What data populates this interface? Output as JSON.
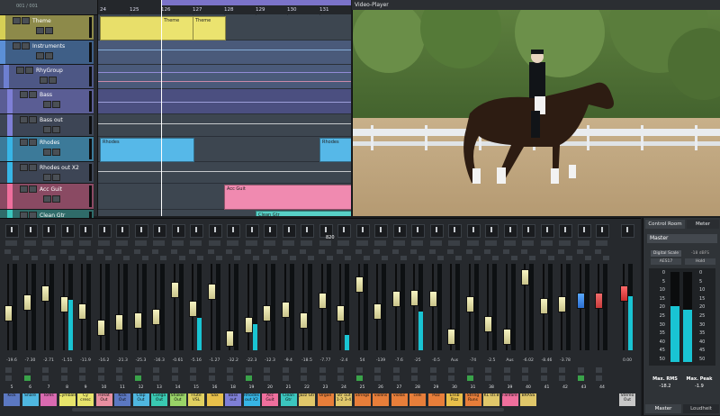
{
  "tracklist": {
    "header": "001 / 001",
    "tracks": [
      {
        "name": "Theme",
        "color": "#d6cf55",
        "row_bg": "#8d8a4a",
        "height": 27
      },
      {
        "name": "Instruments",
        "color": "#5b8fd6",
        "row_bg": "#3f5f87",
        "height": 26
      },
      {
        "name": "RhyGroup",
        "color": "#6d7fd0",
        "row_bg": "#4d5785",
        "height": 26
      },
      {
        "name": "Bass",
        "color": "#7e7fd6",
        "row_bg": "#5a5d94",
        "height": 27
      },
      {
        "name": "Bass out",
        "color": "#7e7fd6",
        "row_bg": "#3d4555",
        "height": 24
      },
      {
        "name": "Rhodes",
        "color": "#37b5e6",
        "row_bg": "#3c7a99",
        "height": 27
      },
      {
        "name": "Rhodes out X2",
        "color": "#37b5e6",
        "row_bg": "#3d4555",
        "height": 23
      },
      {
        "name": "Acc Guit",
        "color": "#ef6f9d",
        "row_bg": "#8a4a63",
        "height": 28
      },
      {
        "name": "Clean Gtr",
        "color": "#3bc6be",
        "row_bg": "#2f6b69",
        "height": 14
      }
    ]
  },
  "arrange": {
    "bars": [
      "24",
      "125",
      "126",
      "127",
      "128",
      "129",
      "130",
      "131"
    ],
    "clips": [
      {
        "label": "",
        "lane": 0
      },
      {
        "label": "Theme",
        "lane": 0
      },
      {
        "label": "Theme",
        "lane": 0
      },
      {
        "label": "Rhodes",
        "lane": 5
      },
      {
        "label": "Rhodes",
        "lane": 5
      },
      {
        "label": "Acc Guit",
        "lane": 7
      },
      {
        "label": "Clean Gtr",
        "lane": 8
      }
    ]
  },
  "video": {
    "title": "Video-Player"
  },
  "mixer": {
    "input_marker": "820",
    "channels": [
      {
        "name": "Kick",
        "num": "5",
        "vol": "-19.6",
        "color": "#5b78c2",
        "level": 0.42,
        "meter": 0.0
      },
      {
        "name": "Snare",
        "num": "6",
        "vol": "-7.30",
        "color": "#4fb7e0",
        "level": 0.58,
        "meter": 0.0
      },
      {
        "name": "Toms",
        "num": "7",
        "vol": "-2.71",
        "color": "#d96ab0",
        "level": 0.7,
        "meter": 0.0
      },
      {
        "name": "Cymbals",
        "num": "8",
        "vol": "-1.51",
        "color": "#e7e46b",
        "level": 0.55,
        "meter": 0.58
      },
      {
        "name": "Cy cresc",
        "num": "9",
        "vol": "-11.9",
        "color": "#e7e46b",
        "level": 0.45,
        "meter": 0.0
      },
      {
        "name": "HiHat Out",
        "num": "10",
        "vol": "-16.2",
        "color": "#e88fa0",
        "level": 0.22,
        "meter": 0.0
      },
      {
        "name": "Kick Out",
        "num": "11",
        "vol": "-21.3",
        "color": "#5b78c2",
        "level": 0.3,
        "meter": 0.0
      },
      {
        "name": "Clap Out",
        "num": "12",
        "vol": "-25.3",
        "color": "#4fb7e0",
        "level": 0.33,
        "meter": 0.0
      },
      {
        "name": "Conga Out",
        "num": "13",
        "vol": "-16.3",
        "color": "#39c9b2",
        "level": 0.37,
        "meter": 0.0
      },
      {
        "name": "Shaker Out",
        "num": "14",
        "vol": "-0.61",
        "color": "#9ad468",
        "level": 0.75,
        "meter": 0.0
      },
      {
        "name": "Flute VSL",
        "num": "15",
        "vol": "-5.16",
        "color": "#e0d060",
        "level": 0.49,
        "meter": 0.38
      },
      {
        "name": "Sax",
        "num": "16",
        "vol": "-1.27",
        "color": "#e8c04a",
        "level": 0.73,
        "meter": 0.0
      },
      {
        "name": "Bass out",
        "num": "18",
        "vol": "-32.2",
        "color": "#7e7fd6",
        "level": 0.08,
        "meter": 0.0
      },
      {
        "name": "Rhodes out X2",
        "num": "19",
        "vol": "-22.3",
        "color": "#37b5e6",
        "level": 0.26,
        "meter": 0.3
      },
      {
        "name": "Acc Guit",
        "num": "20",
        "vol": "-12.3",
        "color": "#ef6f9d",
        "level": 0.42,
        "meter": 0.0
      },
      {
        "name": "Clean Gtr",
        "num": "21",
        "vol": "-9.4",
        "color": "#3bc6be",
        "level": 0.47,
        "meter": 0.0
      },
      {
        "name": "Jazz Gtr",
        "num": "22",
        "vol": "-18.5",
        "color": "#e0c76a",
        "level": 0.33,
        "meter": 0.0
      },
      {
        "name": "Organ",
        "num": "23",
        "vol": "-7.77",
        "color": "#e77e3a",
        "level": 0.6,
        "meter": 0.0
      },
      {
        "name": "Str out 1-2 3-4",
        "num": "24",
        "vol": "-2.4",
        "color": "#e0c76a",
        "level": 0.43,
        "meter": 0.18
      },
      {
        "name": "Strings",
        "num": "25",
        "vol": "54",
        "color": "#e77e3a",
        "level": 0.82,
        "meter": 0.0
      },
      {
        "name": "violins",
        "num": "26",
        "vol": "-139",
        "color": "#e77e3a",
        "level": 0.45,
        "meter": 0.0
      },
      {
        "name": "violas",
        "num": "27",
        "vol": "-7.6",
        "color": "#e77e3a",
        "level": 0.62,
        "meter": 0.0
      },
      {
        "name": "celli",
        "num": "28",
        "vol": "-25",
        "color": "#e77e3a",
        "level": 0.64,
        "meter": 0.45
      },
      {
        "name": "Pizz",
        "num": "29",
        "vol": "-0.5",
        "color": "#e77e3a",
        "level": 0.63,
        "meter": 0.0
      },
      {
        "name": "Ensb Pizz",
        "num": "30",
        "vol": "Aus",
        "color": "#e8c04a",
        "level": 0.1,
        "meter": 0.0
      },
      {
        "name": "String Runs",
        "num": "31",
        "vol": "-74",
        "color": "#e77e3a",
        "level": 0.55,
        "meter": 0.0
      },
      {
        "name": "KL str.8",
        "num": "38",
        "vol": "-2.5",
        "color": "#e0c76a",
        "level": 0.28,
        "meter": 0.0
      },
      {
        "name": "Fanfare",
        "num": "39",
        "vol": "Aus",
        "color": "#ef6f9d",
        "level": 0.1,
        "meter": 0.0
      },
      {
        "name": "BRASS",
        "num": "40",
        "vol": "-6.02",
        "color": "#e0c76a",
        "level": 0.92,
        "meter": 0.0
      },
      {
        "name": "",
        "num": "41",
        "vol": "-8.46",
        "color": "#7e7fd6",
        "level": 0.52,
        "meter": 0.0
      },
      {
        "name": "",
        "num": "42",
        "vol": "-3.78",
        "color": "#ef6f9d",
        "level": 0.55,
        "meter": 0.0
      },
      {
        "name": "",
        "num": "43",
        "vol": "",
        "color": "#2c6fd0",
        "level": 0.6,
        "meter": 0.0
      },
      {
        "name": "",
        "num": "44",
        "vol": "",
        "color": "#c8c8c8",
        "level": 0.6,
        "meter": 0.0
      }
    ],
    "master_strip": {
      "name": "Stereo Out",
      "vol": "0.00",
      "level": 0.7
    }
  },
  "right_panel": {
    "tabs": [
      "Control Room",
      "Meter"
    ],
    "master_label": "Master",
    "digital_scale": "Digital Scale",
    "scale_value": "-18 dBFS",
    "reset1": "AES17",
    "reset2": "Hold",
    "db_scale": [
      "0",
      "5",
      "10",
      "15",
      "20",
      "25",
      "30",
      "35",
      "40",
      "45",
      "50"
    ],
    "meter_levels": [
      0.62,
      0.58
    ],
    "max_rms_label": "Max. RMS",
    "max_rms": "-18.2",
    "max_peak_label": "Max. Peak",
    "max_peak": "-1.9",
    "bottom_tabs": [
      "Master",
      "Loudheit"
    ]
  }
}
